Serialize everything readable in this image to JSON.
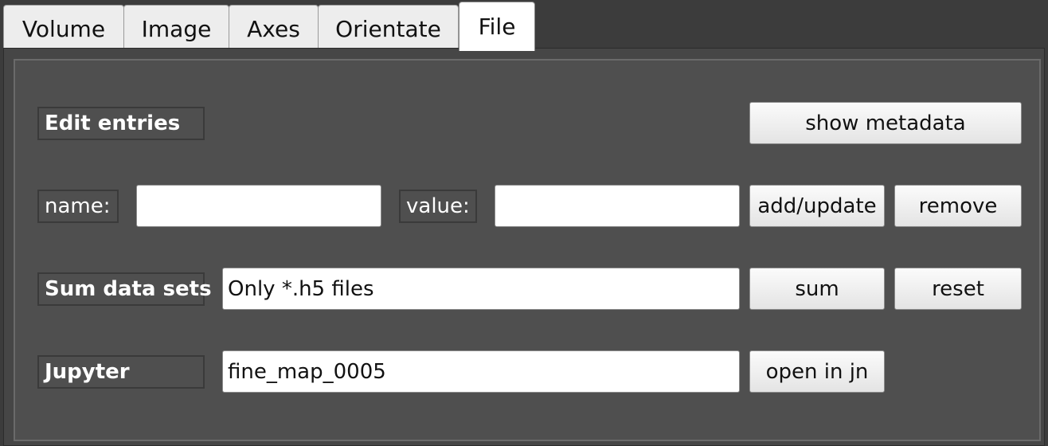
{
  "tabs": [
    {
      "label": "Volume",
      "active": false
    },
    {
      "label": "Image",
      "active": false
    },
    {
      "label": "Axes",
      "active": false
    },
    {
      "label": "Orientate",
      "active": false
    },
    {
      "label": "File",
      "active": true
    }
  ],
  "edit_entries": {
    "title": "Edit entries",
    "show_metadata_label": "show metadata",
    "name_label": "name:",
    "name_value": "",
    "value_label": "value:",
    "value_value": "",
    "add_update_label": "add/update",
    "remove_label": "remove"
  },
  "sum_data_sets": {
    "title": "Sum data sets",
    "input_value": "Only *.h5 files",
    "sum_label": "sum",
    "reset_label": "reset"
  },
  "jupyter": {
    "title": "Jupyter",
    "input_value": "fine_map_0005",
    "open_label": "open in jn"
  }
}
